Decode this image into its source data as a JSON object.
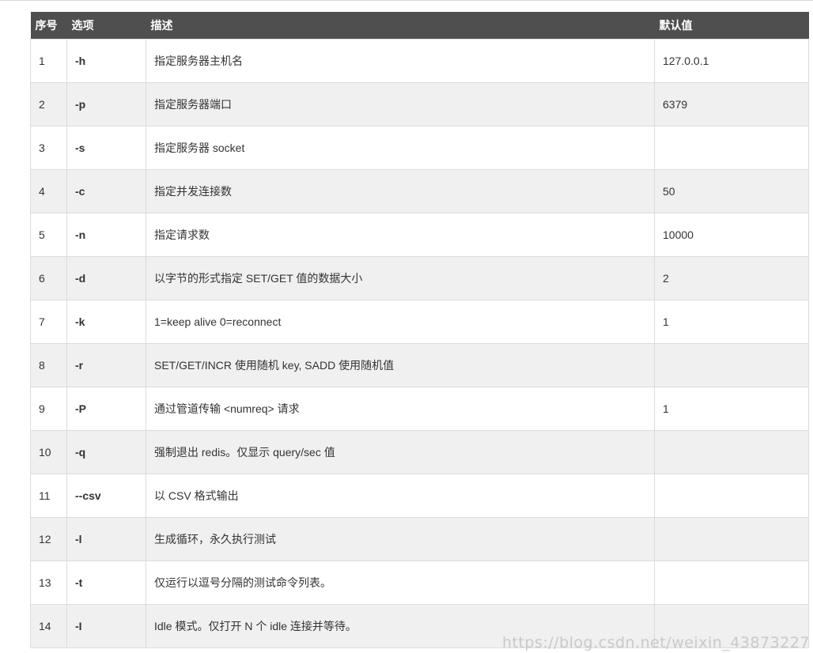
{
  "table": {
    "headers": {
      "index": "序号",
      "option": "选项",
      "description": "描述",
      "default": "默认值"
    },
    "rows": [
      {
        "index": "1",
        "option": "-h",
        "description": "指定服务器主机名",
        "default": "127.0.0.1"
      },
      {
        "index": "2",
        "option": "-p",
        "description": "指定服务器端口",
        "default": "6379"
      },
      {
        "index": "3",
        "option": "-s",
        "description": "指定服务器 socket",
        "default": ""
      },
      {
        "index": "4",
        "option": "-c",
        "description": "指定并发连接数",
        "default": "50"
      },
      {
        "index": "5",
        "option": "-n",
        "description": "指定请求数",
        "default": "10000"
      },
      {
        "index": "6",
        "option": "-d",
        "description": "以字节的形式指定 SET/GET 值的数据大小",
        "default": "2"
      },
      {
        "index": "7",
        "option": "-k",
        "description": "1=keep alive 0=reconnect",
        "default": "1"
      },
      {
        "index": "8",
        "option": "-r",
        "description": "SET/GET/INCR 使用随机 key, SADD 使用随机值",
        "default": ""
      },
      {
        "index": "9",
        "option": "-P",
        "description": "通过管道传输 <numreq> 请求",
        "default": "1"
      },
      {
        "index": "10",
        "option": "-q",
        "description": "强制退出 redis。仅显示 query/sec 值",
        "default": ""
      },
      {
        "index": "11",
        "option": "--csv",
        "description": "以 CSV 格式输出",
        "default": ""
      },
      {
        "index": "12",
        "option": "-l",
        "description": "生成循环，永久执行测试",
        "default": ""
      },
      {
        "index": "13",
        "option": "-t",
        "description": "仅运行以逗号分隔的测试命令列表。",
        "default": ""
      },
      {
        "index": "14",
        "option": "-I",
        "description": "Idle 模式。仅打开 N 个 idle 连接并等待。",
        "default": ""
      }
    ]
  },
  "watermark": "https://blog.csdn.net/weixin_43873227"
}
